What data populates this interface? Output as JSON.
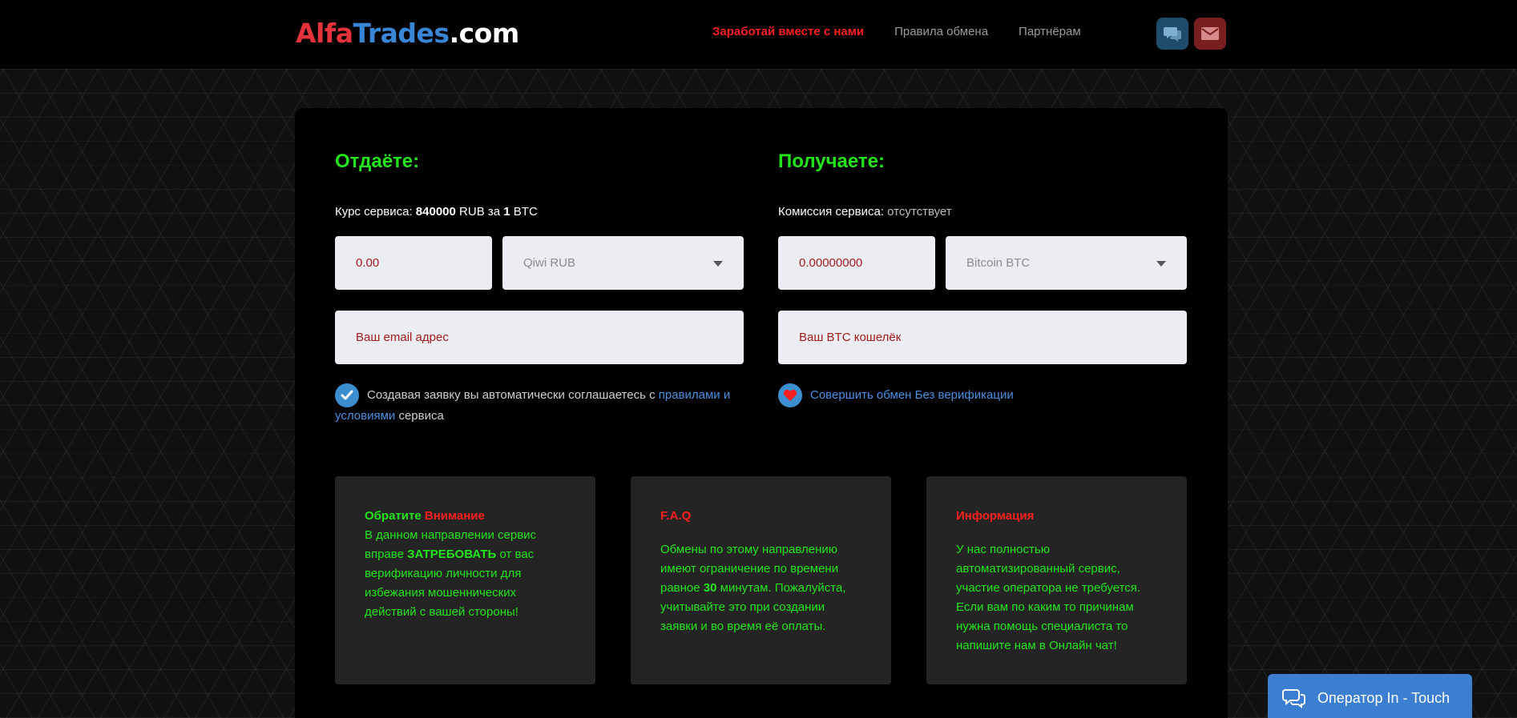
{
  "header": {
    "logo": {
      "part1": "Alfa",
      "part2": "Trades",
      "part3": ".com"
    },
    "nav": [
      "Заработай вместе с нами",
      "Правила обмена",
      "Партнёрам"
    ]
  },
  "give": {
    "title": "Отдаёте:",
    "rate_label": "Курс сервиса:",
    "rate_amount": "840000",
    "rate_currency": "RUB за",
    "rate_unit": "1",
    "rate_target": "BTC",
    "amount_value": "0.00",
    "currency_select": "Qiwi RUB",
    "email_placeholder": "Ваш email адрес",
    "agree_text": "Создавая заявку вы автоматически соглашаетесь с",
    "agree_link": "правилами и условиями",
    "agree_suffix": "сервиса"
  },
  "receive": {
    "title": "Получаете:",
    "commission_label": "Комиссия сервиса:",
    "commission_value": "отсутствует",
    "amount_value": "0.00000000",
    "currency_select": "Bitcoin BTC",
    "wallet_placeholder": "Ваш BTC кошелёк",
    "no_verify_link": "Совершить обмен Без верификации"
  },
  "cards": [
    {
      "title_green": "Обратите",
      "title_red": "Внимание",
      "text_a": "В данном направлении сервис вправе",
      "text_b": "ЗАТРЕБОВАТЬ",
      "text_c": "от вас верификацию личности для избежания мошеннических действий с вашей стороны!"
    },
    {
      "title": "F.A.Q",
      "text_a": "Обмены по этому направлению имеют ограничение по времени равное",
      "text_b": "30",
      "text_c": "минутам. Пожалуйста, учитывайте это при создании заявки и во время её оплаты."
    },
    {
      "title": "Информация",
      "text": "У нас полностью автоматизированный сервис, участие оператора не требуется. Если вам по каким то причинам нужна помощь специалиста то напишите нам в Онлайн чат!"
    }
  ],
  "operator_label": "Оператор In - Touch",
  "colors": {
    "accent_green": "#22e51b",
    "accent_red": "#ff1f1f",
    "link_blue": "#4a90e2"
  },
  "icons": [
    "chat-icon",
    "mail-icon",
    "checkmark-icon",
    "heart-icon",
    "chevron-down-icon",
    "operator-chat-icon"
  ]
}
